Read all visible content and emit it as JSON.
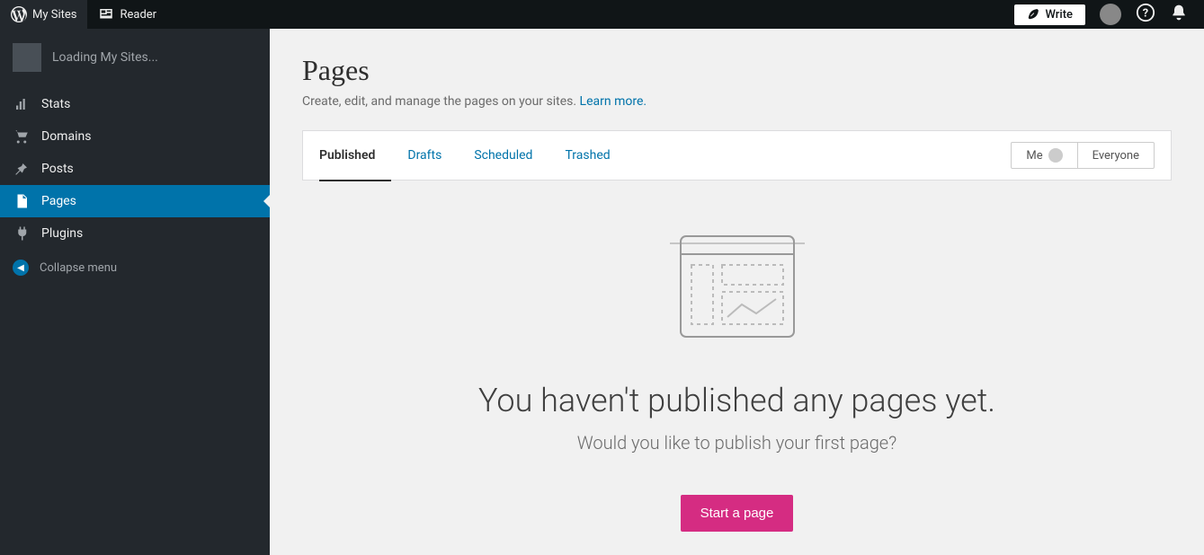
{
  "topbar": {
    "my_sites": "My Sites",
    "reader": "Reader",
    "write": "Write"
  },
  "sidebar": {
    "loading": "Loading My Sites...",
    "items": [
      {
        "label": "Stats"
      },
      {
        "label": "Domains"
      },
      {
        "label": "Posts"
      },
      {
        "label": "Pages"
      },
      {
        "label": "Plugins"
      }
    ],
    "collapse": "Collapse menu"
  },
  "header": {
    "title": "Pages",
    "description": "Create, edit, and manage the pages on your sites. ",
    "learn_more": "Learn more."
  },
  "tabs": {
    "published": "Published",
    "drafts": "Drafts",
    "scheduled": "Scheduled",
    "trashed": "Trashed"
  },
  "author_filter": {
    "me": "Me",
    "everyone": "Everyone"
  },
  "empty": {
    "heading": "You haven't published any pages yet.",
    "sub": "Would you like to publish your first page?",
    "cta": "Start a page"
  }
}
